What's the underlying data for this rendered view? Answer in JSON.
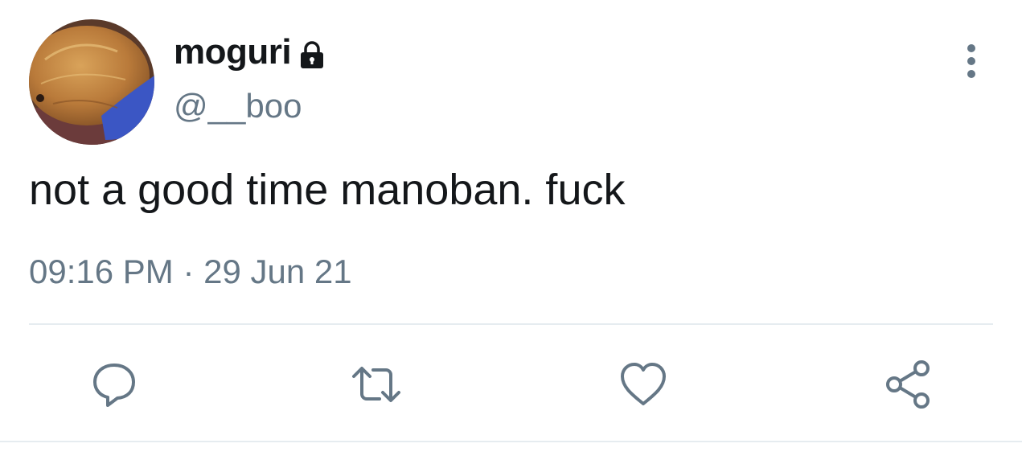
{
  "user": {
    "display_name": "moguri",
    "handle": "@__boo",
    "protected_icon": "lock-icon",
    "avatar": "dog-photo-avatar"
  },
  "tweet": {
    "text": "not a good time manoban. fuck",
    "timestamp": "09:16 PM · 29 Jun 21"
  },
  "actions": {
    "reply_icon": "reply-icon",
    "retweet_icon": "retweet-icon",
    "like_icon": "heart-icon",
    "share_icon": "share-icon",
    "more_icon": "more-vertical-icon"
  },
  "colors": {
    "text_primary": "#14171a",
    "text_secondary": "#657786",
    "divider": "#e6ecf0"
  }
}
